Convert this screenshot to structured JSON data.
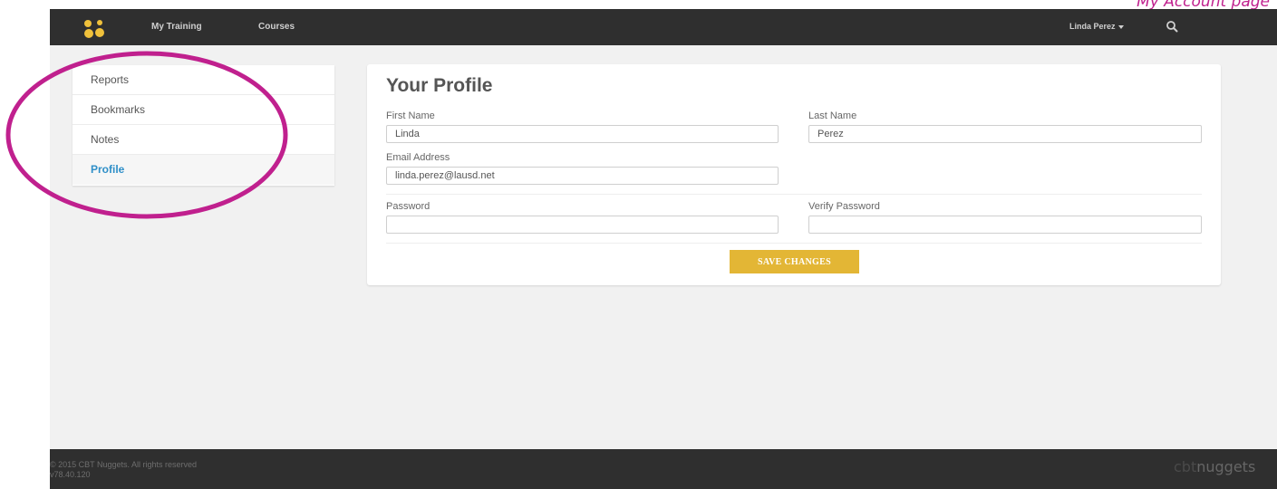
{
  "caption": "My Account page",
  "nav": {
    "links": [
      "My Training",
      "Courses"
    ],
    "user": "Linda Perez"
  },
  "sidebar": {
    "items": [
      {
        "label": "Reports"
      },
      {
        "label": "Bookmarks"
      },
      {
        "label": "Notes"
      },
      {
        "label": "Profile",
        "active": true
      }
    ]
  },
  "profile": {
    "title": "Your Profile",
    "first_name": {
      "label": "First Name",
      "value": "Linda"
    },
    "last_name": {
      "label": "Last Name",
      "value": "Perez"
    },
    "email": {
      "label": "Email Address",
      "value": "linda.perez@lausd.net"
    },
    "password": {
      "label": "Password",
      "value": ""
    },
    "verify_password": {
      "label": "Verify Password",
      "value": ""
    },
    "save_label": "SAVE CHANGES"
  },
  "footer": {
    "copyright": "© 2015 CBT Nuggets. All rights reserved",
    "version": "v78.40.120",
    "logo_text_left": "cbt",
    "logo_text_right": "nuggets"
  },
  "colors": {
    "accent_gold": "#e3b635",
    "active_link": "#2f8fc8",
    "highlight_ring": "#c0208e",
    "nav_bg": "#2f2f2f"
  },
  "icons": [
    "logo-icon",
    "chevron-down-icon",
    "search-icon"
  ]
}
